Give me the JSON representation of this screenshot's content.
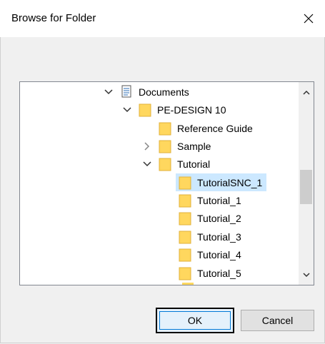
{
  "window": {
    "title": "Browse for Folder"
  },
  "tree": {
    "items": [
      {
        "label": "Documents",
        "expander": "expanded",
        "icon": "documents-icon"
      },
      {
        "label": "PE-DESIGN 10",
        "expander": "expanded",
        "icon": "folder-icon"
      },
      {
        "label": "Reference Guide",
        "expander": "none",
        "icon": "folder-icon"
      },
      {
        "label": "Sample",
        "expander": "collapsed",
        "icon": "folder-icon"
      },
      {
        "label": "Tutorial",
        "expander": "expanded",
        "icon": "folder-icon"
      },
      {
        "label": "TutorialSNC_1",
        "expander": "none",
        "icon": "folder-icon",
        "selected": true
      },
      {
        "label": "Tutorial_1",
        "expander": "none",
        "icon": "folder-icon"
      },
      {
        "label": "Tutorial_2",
        "expander": "none",
        "icon": "folder-icon"
      },
      {
        "label": "Tutorial_3",
        "expander": "none",
        "icon": "folder-icon"
      },
      {
        "label": "Tutorial_4",
        "expander": "none",
        "icon": "folder-icon"
      },
      {
        "label": "Tutorial_5",
        "expander": "none",
        "icon": "folder-icon"
      }
    ]
  },
  "buttons": {
    "ok": "OK",
    "cancel": "Cancel"
  },
  "colors": {
    "folder": "#ffd75e",
    "selection": "#cce8ff",
    "accent": "#0078d7"
  }
}
